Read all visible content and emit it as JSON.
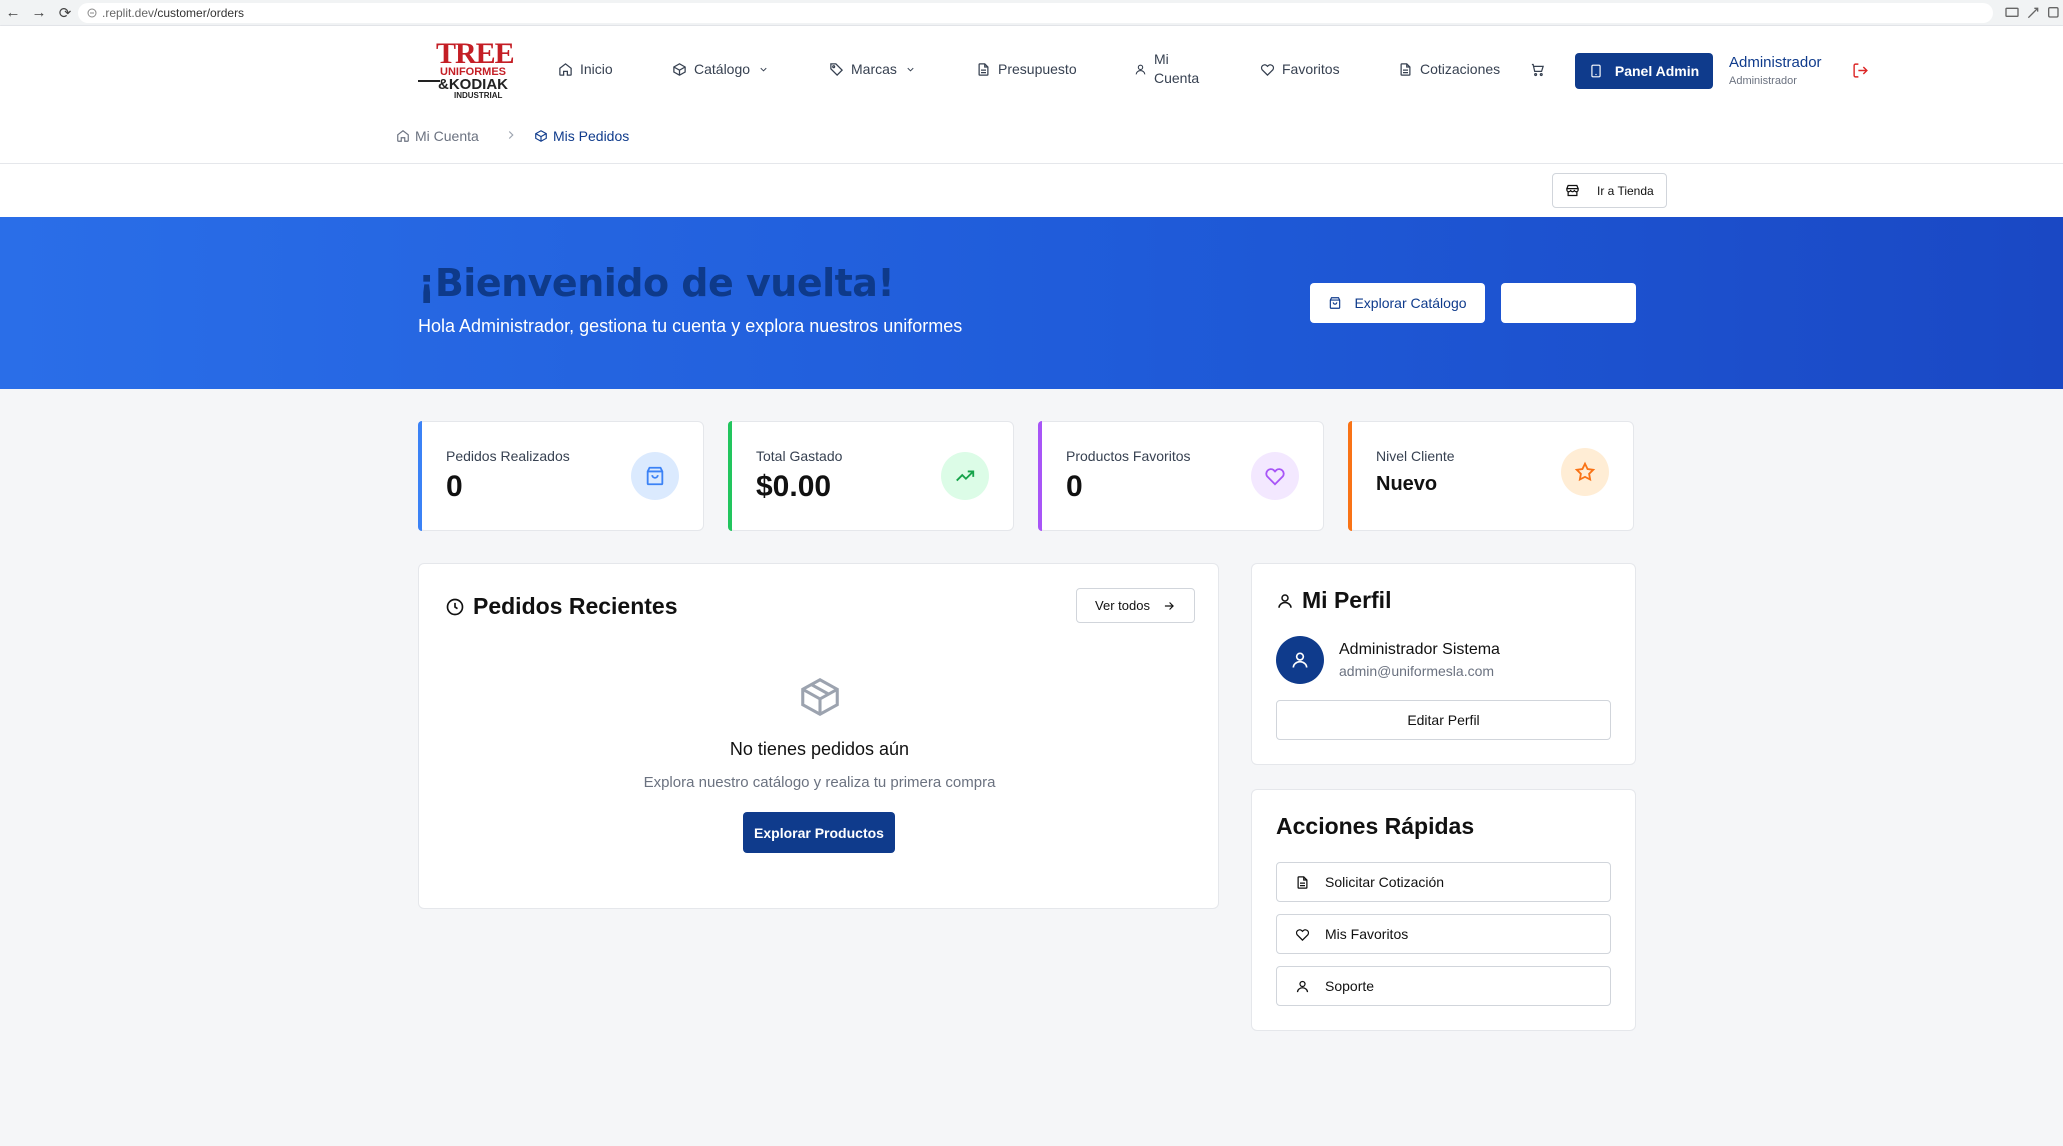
{
  "browser": {
    "url_prefix": ".replit.dev",
    "url_path": "/customer/orders"
  },
  "logo": {
    "line1": "TREE",
    "line2": "UNIFORMES",
    "line3": "&KODIAK",
    "line4": "INDUSTRIAL"
  },
  "nav": {
    "inicio": "Inicio",
    "catalogo": "Catálogo",
    "marcas": "Marcas",
    "presupuesto": "Presupuesto",
    "mi_cuenta_1": "Mi",
    "mi_cuenta_2": "Cuenta",
    "favoritos": "Favoritos",
    "cotizaciones": "Cotizaciones"
  },
  "header": {
    "admin_button": "Panel Admin",
    "user_name": "Administrador",
    "user_role": "Administrador"
  },
  "breadcrumb": {
    "home": "Mi Cuenta",
    "current": "Mis Pedidos"
  },
  "store_button": "Ir a Tienda",
  "hero": {
    "title": "¡Bienvenido de vuelta!",
    "subtitle": "Hola Administrador, gestiona tu cuenta y explora nuestros uniformes",
    "explore_button": "Explorar Catálogo"
  },
  "stats": [
    {
      "label": "Pedidos Realizados",
      "value": "0",
      "color": "#3b82f6"
    },
    {
      "label": "Total Gastado",
      "value": "$0.00",
      "color": "#22c55e"
    },
    {
      "label": "Productos Favoritos",
      "value": "0",
      "color": "#a855f7"
    },
    {
      "label": "Nivel Cliente",
      "value": "Nuevo",
      "color": "#f97316"
    }
  ],
  "recent": {
    "title": "Pedidos Recientes",
    "view_all": "Ver todos",
    "empty_title": "No tienes pedidos aún",
    "empty_subtitle": "Explora nuestro catálogo y realiza tu primera compra",
    "explore_button": "Explorar Productos"
  },
  "profile": {
    "title": "Mi Perfil",
    "name": "Administrador Sistema",
    "email": "admin@uniformesla.com",
    "edit_button": "Editar Perfil"
  },
  "quick_actions": {
    "title": "Acciones Rápidas",
    "items": [
      {
        "label": "Solicitar Cotización",
        "icon": "document-icon"
      },
      {
        "label": "Mis Favoritos",
        "icon": "heart-icon"
      },
      {
        "label": "Soporte",
        "icon": "user-icon"
      }
    ]
  },
  "colors": {
    "primary": "#0f3b8c",
    "hero": "#1f5bd9",
    "logo_red": "#c41e25"
  }
}
